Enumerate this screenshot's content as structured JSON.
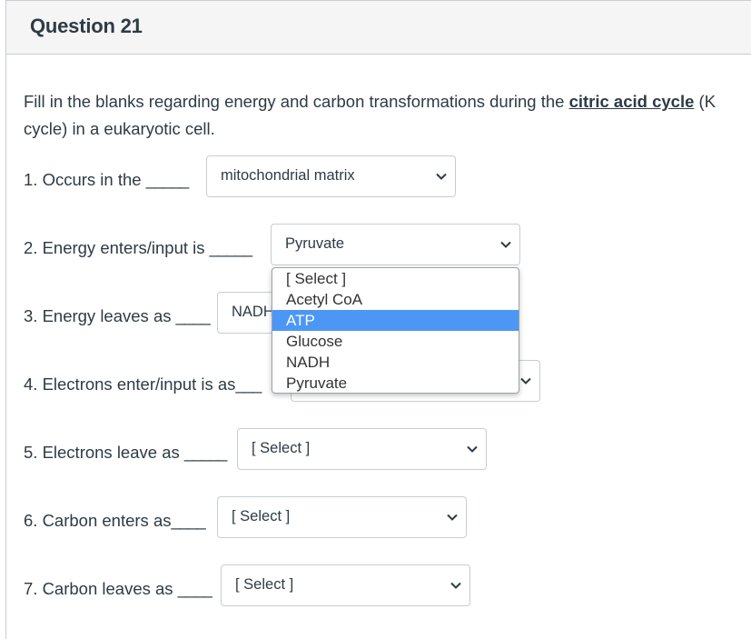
{
  "question": {
    "title": "Question 21"
  },
  "prompt": {
    "line1_before": "Fill in the blanks regarding energy and carbon transformations during the ",
    "link": "citric acid cycle",
    "line1_after": " (K",
    "line2": "cycle) in a eukaryotic cell."
  },
  "rows": [
    {
      "label": "1. Occurs in the ",
      "blank": "_____",
      "value": "mitochondrial matrix"
    },
    {
      "label": "2. Energy enters/input is ",
      "blank": "_____",
      "value": "Pyruvate"
    },
    {
      "label": "3. Energy leaves as ",
      "blank": "____",
      "value": "NADH"
    },
    {
      "label": "4. Electrons enter/input is as",
      "blank": "___",
      "value": ""
    },
    {
      "label": "5. Electrons leave as ",
      "blank": "_____",
      "value": "[ Select ]"
    },
    {
      "label": "6. Carbon enters as",
      "blank": "____",
      "value": "[ Select ]"
    },
    {
      "label": "7. Carbon leaves as ",
      "blank": "____",
      "value": "[ Select ]"
    }
  ],
  "dropdown": {
    "options": [
      "[ Select ]",
      "Acetyl CoA",
      "ATP",
      "Glucose",
      "NADH",
      "Pyruvate"
    ],
    "highlighted": "ATP"
  },
  "colors": {
    "highlight": "#4c97f5",
    "text": "#2d3b45",
    "border": "#c7cdd1"
  }
}
